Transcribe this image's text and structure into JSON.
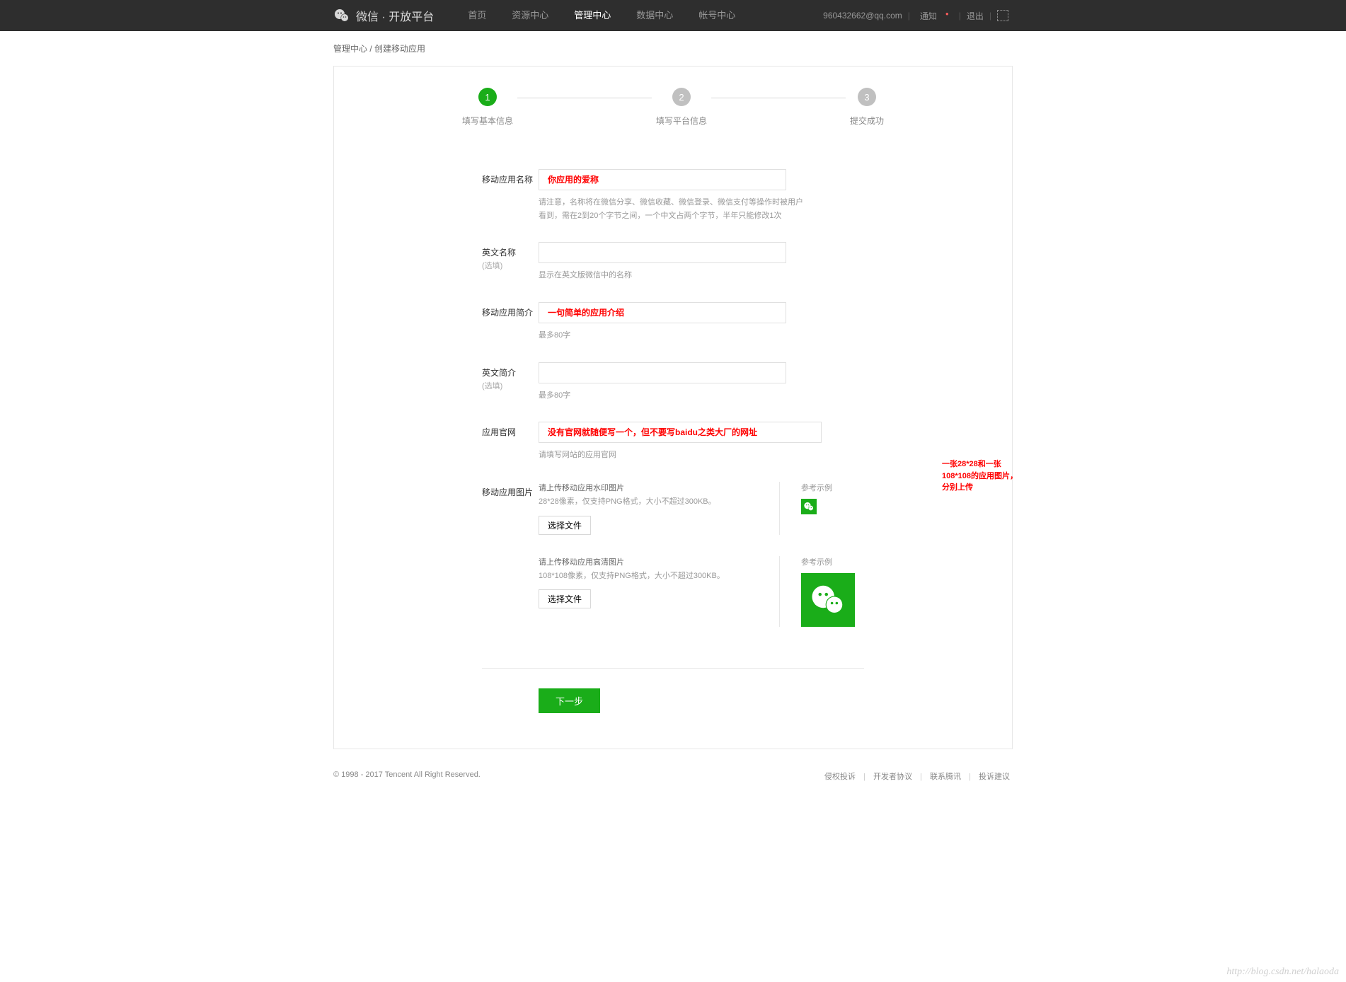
{
  "header": {
    "logo_text": "微信 · 开放平台",
    "nav": [
      "首页",
      "资源中心",
      "管理中心",
      "数据中心",
      "帐号中心"
    ],
    "active_index": 2,
    "email": "960432662@qq.com",
    "notify": "通知",
    "logout": "退出"
  },
  "breadcrumb": "管理中心 / 创建移动应用",
  "steps": [
    {
      "num": "1",
      "label": "填写基本信息",
      "active": true
    },
    {
      "num": "2",
      "label": "填写平台信息",
      "active": false
    },
    {
      "num": "3",
      "label": "提交成功",
      "active": false
    }
  ],
  "form": {
    "name": {
      "label": "移动应用名称",
      "placeholder": "你应用的爱称",
      "hint": "请注意，名称将在微信分享、微信收藏、微信登录、微信支付等操作时被用户看到，需在2到20个字节之间，一个中文占两个字节，半年只能修改1次"
    },
    "en_name": {
      "label": "英文名称",
      "sublabel": "(选填)",
      "hint": "显示在英文版微信中的名称"
    },
    "desc": {
      "label": "移动应用简介",
      "placeholder": "一句简单的应用介绍",
      "hint": "最多80字"
    },
    "en_desc": {
      "label": "英文简介",
      "sublabel": "(选填)",
      "hint": "最多80字"
    },
    "website": {
      "label": "应用官网",
      "placeholder": "没有官网就随便写一个，但不要写baidu之类大厂的网址",
      "hint": "请填写网站的应用官网"
    },
    "images": {
      "label": "移动应用图片",
      "small": {
        "title": "请上传移动应用水印图片",
        "desc": "28*28像素，仅支持PNG格式，大小不超过300KB。",
        "btn": "选择文件",
        "example_label": "参考示例"
      },
      "large": {
        "title": "请上传移动应用高清图片",
        "desc": "108*108像素，仅支持PNG格式，大小不超过300KB。",
        "btn": "选择文件",
        "example_label": "参考示例"
      },
      "annotation": "一张28*28和一张108*108的应用图片，分别上传"
    }
  },
  "submit": "下一步",
  "footer": {
    "copyright": "© 1998 - 2017 Tencent All Right Reserved.",
    "links": [
      "侵权投诉",
      "开发者协议",
      "联系腾讯",
      "投诉建议"
    ]
  },
  "watermark": "http://blog.csdn.net/halaoda"
}
